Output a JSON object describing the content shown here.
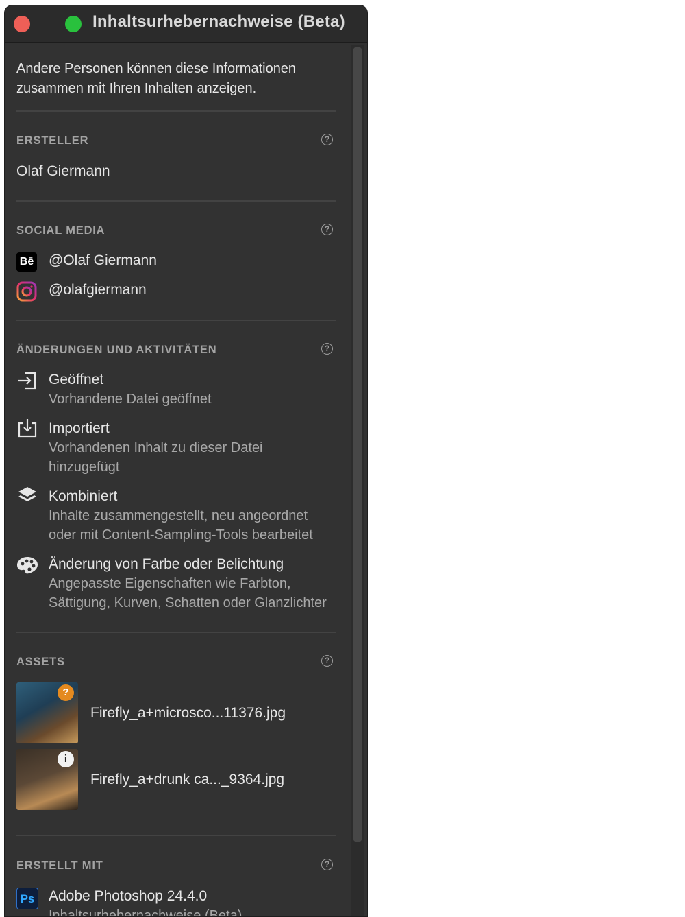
{
  "window": {
    "title": "Inhaltsurhebernachweise (Beta)"
  },
  "intro": "Andere Personen können diese Informationen zusammen mit Ihren Inhalten anzeigen.",
  "help_glyph": "?",
  "ersteller": {
    "title": "ERSTELLER",
    "name": "Olaf Giermann"
  },
  "social": {
    "title": "SOCIAL MEDIA",
    "items": [
      {
        "icon": "behance-icon",
        "icon_text": "Bē",
        "handle": "@Olaf Giermann"
      },
      {
        "icon": "instagram-icon",
        "handle": "@olafgiermann"
      }
    ]
  },
  "changes": {
    "title": "ÄNDERUNGEN UND AKTIVITÄTEN",
    "items": [
      {
        "icon": "open-icon",
        "label": "Geöffnet",
        "desc": "Vorhandene Datei geöffnet"
      },
      {
        "icon": "import-icon",
        "label": "Importiert",
        "desc": "Vorhandenen Inhalt zu dieser Datei hinzugefügt"
      },
      {
        "icon": "layers-icon",
        "label": "Kombiniert",
        "desc": "Inhalte zusammengestellt, neu angeordnet oder mit Content-Sampling-Tools bearbeitet"
      },
      {
        "icon": "palette-icon",
        "label": "Änderung von Farbe oder Belichtung",
        "desc": "Angepasste Eigenschaften wie Farbton, Sättigung, Kurven, Schatten oder Glanzlichter"
      }
    ]
  },
  "assets": {
    "title": "ASSETS",
    "items": [
      {
        "name": "Firefly_a+microsco...11376.jpg",
        "badge": "?"
      },
      {
        "name": "Firefly_a+drunk ca..._9364.jpg",
        "badge": "i"
      }
    ]
  },
  "erstellt_mit": {
    "title": "ERSTELLT MIT",
    "app_icon": "Ps",
    "app": "Adobe Photoshop 24.4.0",
    "sub": "Inhaltsurhebernachweise (Beta)"
  },
  "colors": {
    "accent_red": "#ee5f57",
    "accent_green": "#29c13d",
    "panel_bg": "#323232"
  }
}
